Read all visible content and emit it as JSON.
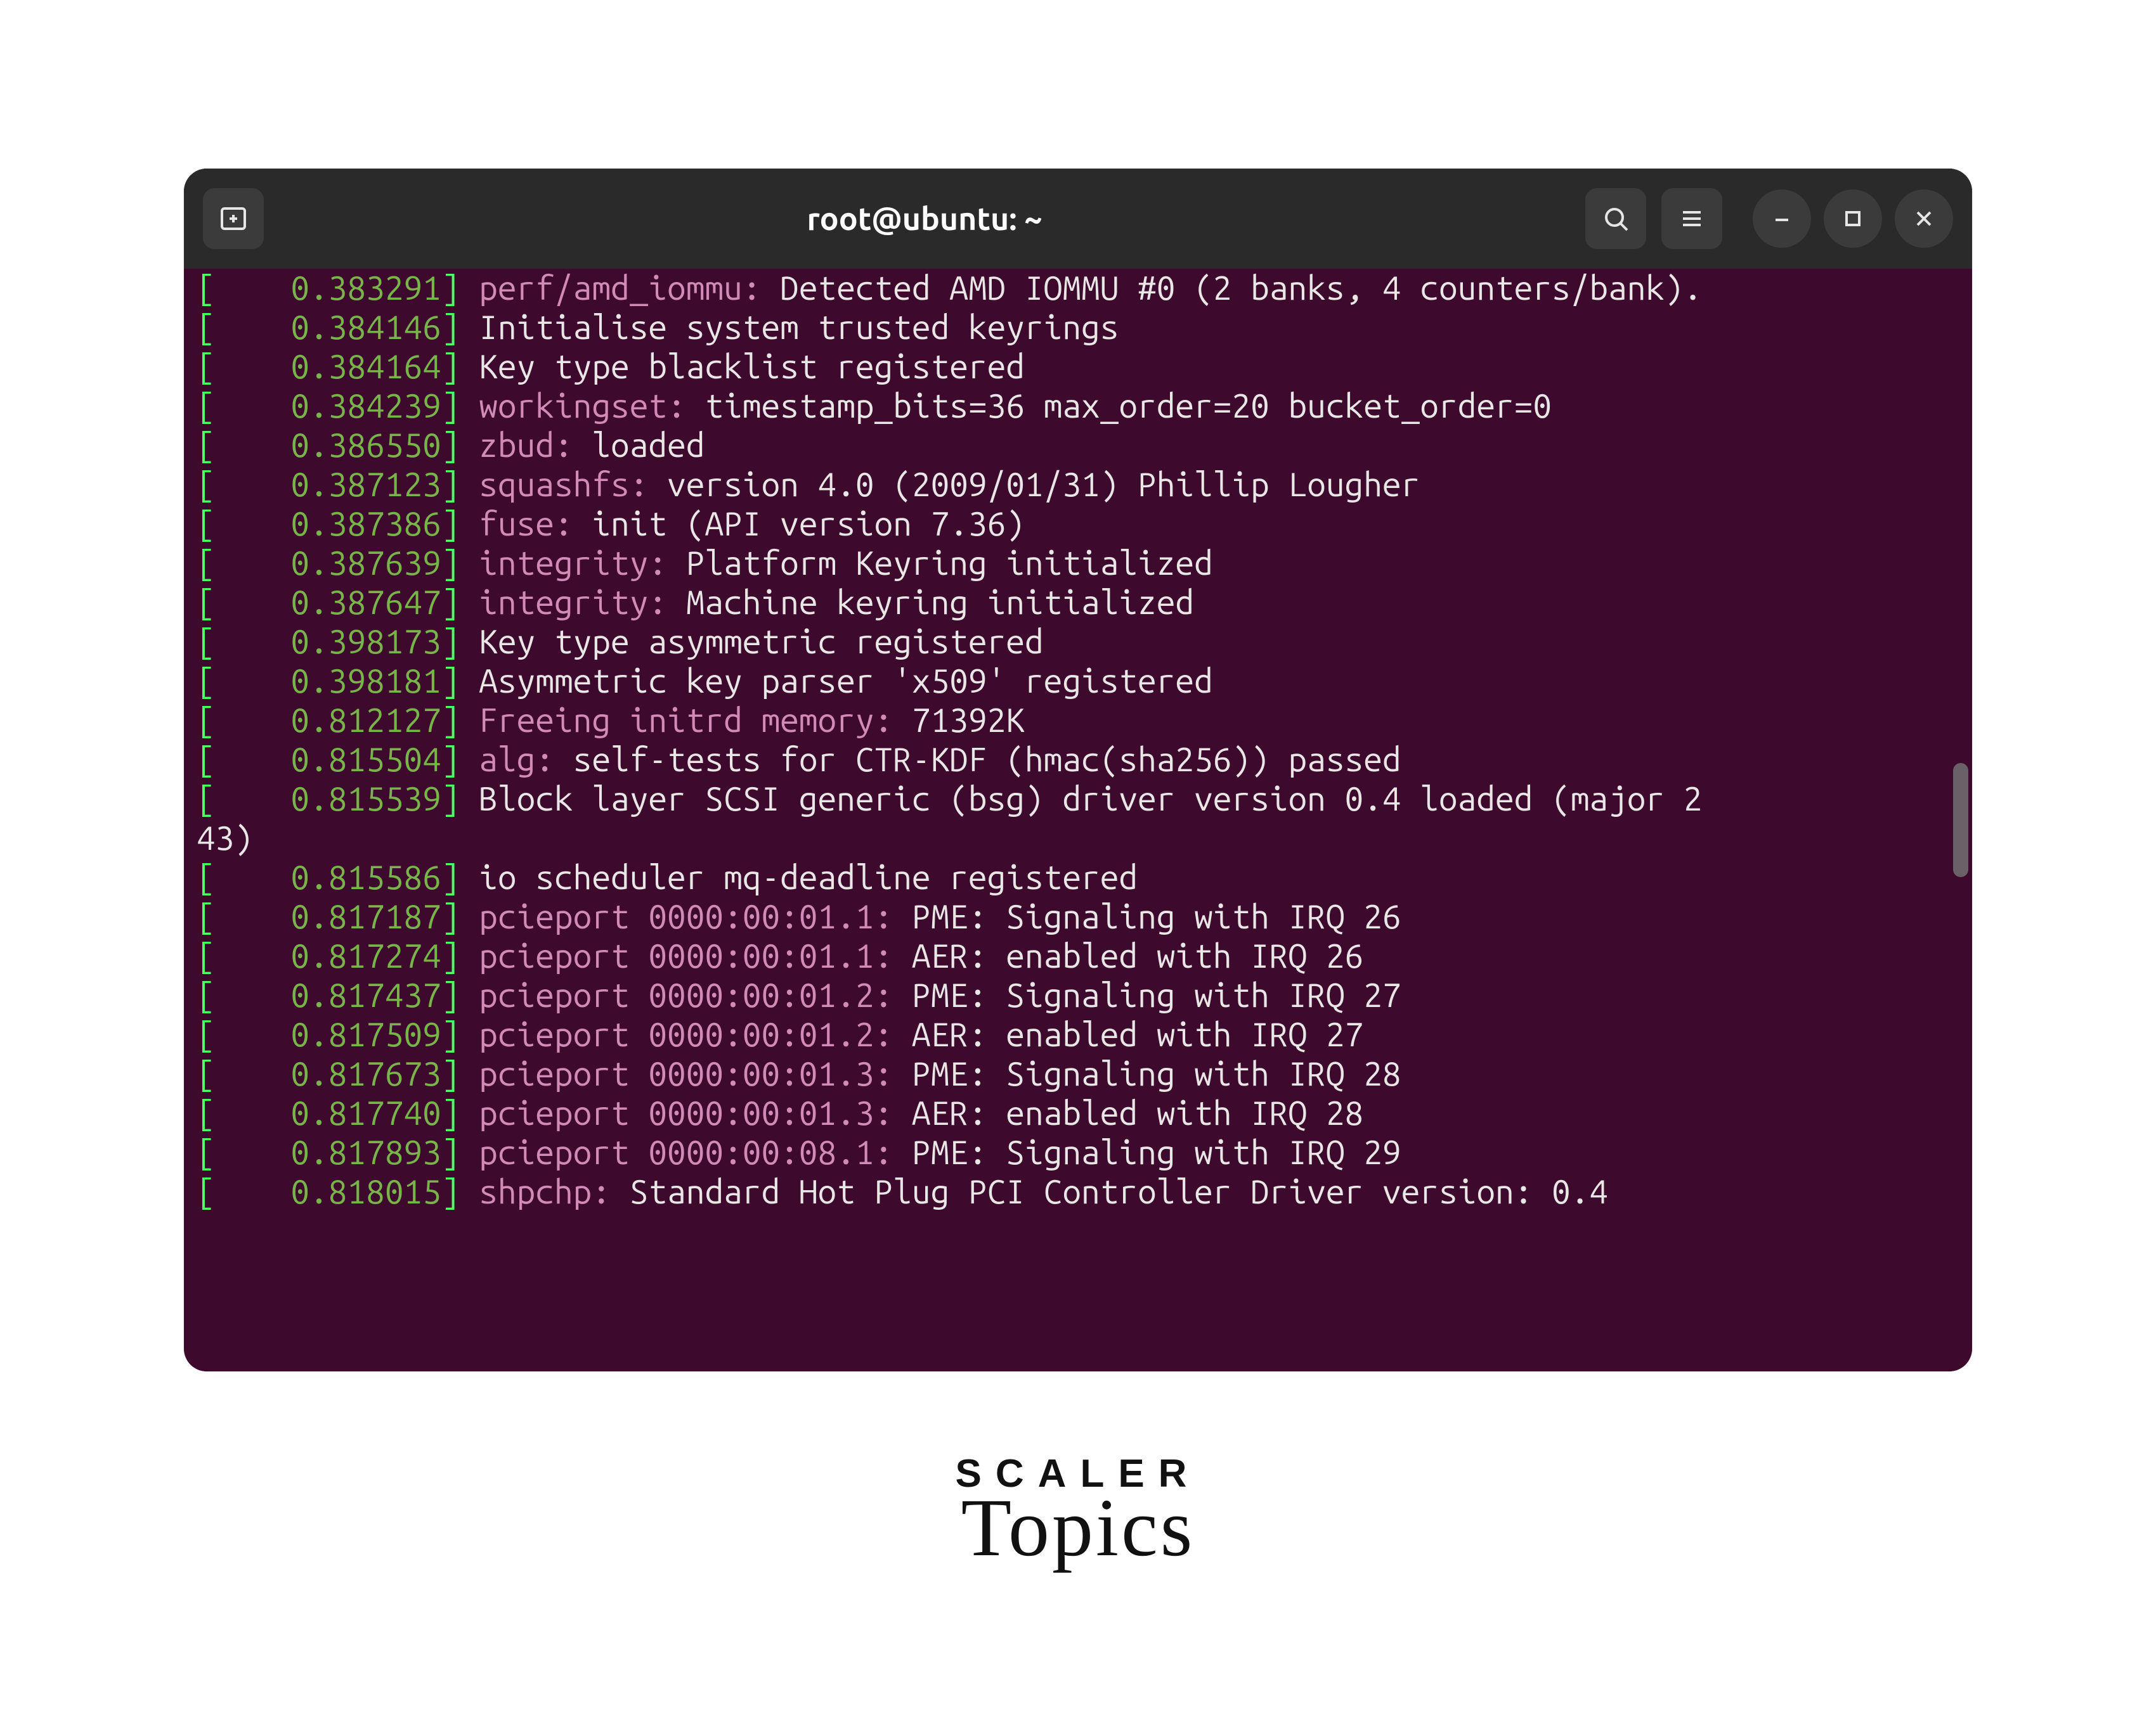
{
  "titlebar": {
    "title": "root@ubuntu: ~"
  },
  "brand": {
    "line1": "SCALER",
    "line2": "Topics"
  },
  "log": {
    "wrap_continuation": "43)",
    "lines": [
      {
        "ts": "0.383291",
        "mod": "perf/amd_iommu",
        "sep": ": ",
        "msg": "Detected AMD IOMMU #0 (2 banks, 4 counters/bank)."
      },
      {
        "ts": "0.384146",
        "mod": "",
        "sep": "",
        "msg": "Initialise system trusted keyrings"
      },
      {
        "ts": "0.384164",
        "mod": "",
        "sep": "",
        "msg": "Key type blacklist registered"
      },
      {
        "ts": "0.384239",
        "mod": "workingset",
        "sep": ": ",
        "msg": "timestamp_bits=36 max_order=20 bucket_order=0"
      },
      {
        "ts": "0.386550",
        "mod": "zbud",
        "sep": ": ",
        "msg": "loaded"
      },
      {
        "ts": "0.387123",
        "mod": "squashfs",
        "sep": ": ",
        "msg": "version 4.0 (2009/01/31) Phillip Lougher"
      },
      {
        "ts": "0.387386",
        "mod": "fuse",
        "sep": ": ",
        "msg": "init (API version 7.36)"
      },
      {
        "ts": "0.387639",
        "mod": "integrity",
        "sep": ": ",
        "msg": "Platform Keyring initialized"
      },
      {
        "ts": "0.387647",
        "mod": "integrity",
        "sep": ": ",
        "msg": "Machine keyring initialized"
      },
      {
        "ts": "0.398173",
        "mod": "",
        "sep": "",
        "msg": "Key type asymmetric registered"
      },
      {
        "ts": "0.398181",
        "mod": "",
        "sep": "",
        "msg": "Asymmetric key parser 'x509' registered"
      },
      {
        "ts": "0.812127",
        "mod": "Freeing initrd memory",
        "sep": ": ",
        "msg": "71392K"
      },
      {
        "ts": "0.815504",
        "mod": "alg",
        "sep": ": ",
        "msg": "self-tests for CTR-KDF (hmac(sha256)) passed"
      },
      {
        "ts": "0.815539",
        "mod": "",
        "sep": "",
        "msg": "Block layer SCSI generic (bsg) driver version 0.4 loaded (major 2",
        "wrap": true
      },
      {
        "ts": "0.815586",
        "mod": "",
        "sep": "",
        "msg": "io scheduler mq-deadline registered"
      },
      {
        "ts": "0.817187",
        "mod": "pcieport 0000:00:01.1",
        "sep": ": ",
        "msg": "PME: Signaling with IRQ 26"
      },
      {
        "ts": "0.817274",
        "mod": "pcieport 0000:00:01.1",
        "sep": ": ",
        "msg": "AER: enabled with IRQ 26"
      },
      {
        "ts": "0.817437",
        "mod": "pcieport 0000:00:01.2",
        "sep": ": ",
        "msg": "PME: Signaling with IRQ 27"
      },
      {
        "ts": "0.817509",
        "mod": "pcieport 0000:00:01.2",
        "sep": ": ",
        "msg": "AER: enabled with IRQ 27"
      },
      {
        "ts": "0.817673",
        "mod": "pcieport 0000:00:01.3",
        "sep": ": ",
        "msg": "PME: Signaling with IRQ 28"
      },
      {
        "ts": "0.817740",
        "mod": "pcieport 0000:00:01.3",
        "sep": ": ",
        "msg": "AER: enabled with IRQ 28"
      },
      {
        "ts": "0.817893",
        "mod": "pcieport 0000:00:08.1",
        "sep": ": ",
        "msg": "PME: Signaling with IRQ 29"
      },
      {
        "ts": "0.818015",
        "mod": "shpchp",
        "sep": ": ",
        "msg": "Standard Hot Plug PCI Controller Driver version: 0.4"
      }
    ]
  }
}
